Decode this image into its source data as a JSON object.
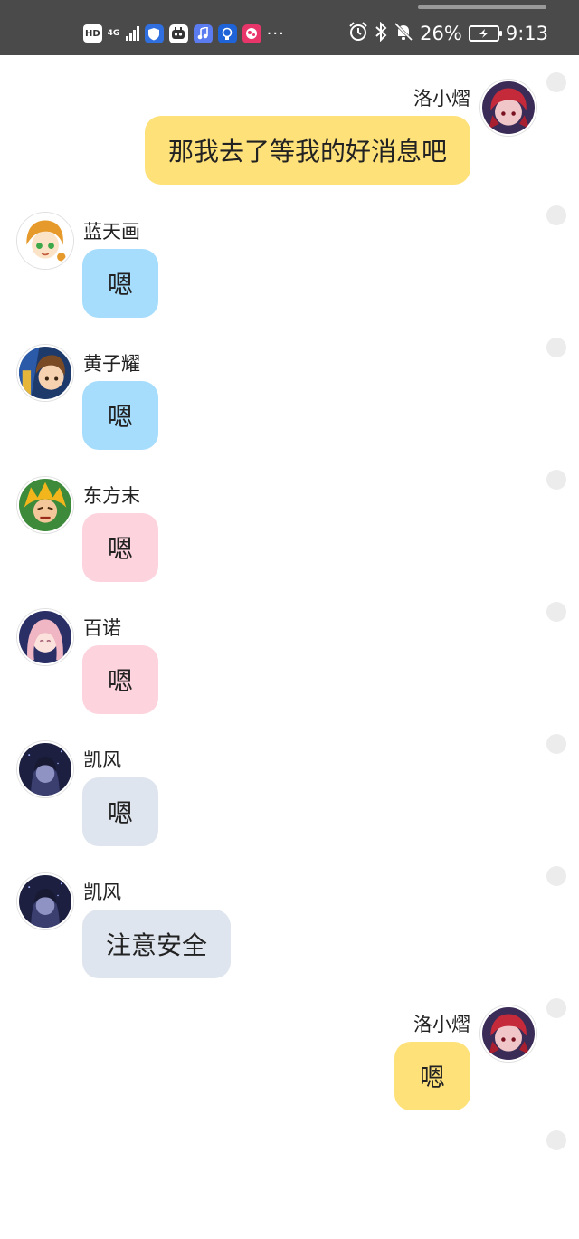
{
  "status_bar": {
    "hd_label": "HD",
    "network_label": "4G",
    "more": "···",
    "battery_percent": "26%",
    "time": "9:13",
    "icons": [
      "hd-icon",
      "signal-4g-icon",
      "shield-app-icon",
      "robot-app-icon",
      "music-app-icon",
      "bulb-app-icon",
      "game-app-icon",
      "alarm-icon",
      "bluetooth-icon",
      "mute-bell-icon",
      "battery-icon"
    ]
  },
  "colors": {
    "status_bar_bg": "#4a4a4a",
    "bubble_self": "#ffe17a",
    "bubble_blue": "#a6dcfc",
    "bubble_pink": "#fdd3de",
    "bubble_gray": "#dfe5ee",
    "dot": "#ececec"
  },
  "messages": [
    {
      "sender": "洛小熠",
      "text": "那我去了等我的好消息吧",
      "side": "right",
      "bubble_color": "#ffe17a",
      "avatar": "red-hair-avatar"
    },
    {
      "sender": "蓝天画",
      "text": "嗯",
      "side": "left",
      "bubble_color": "#a6dcfc",
      "avatar": "green-eyed-girl-avatar"
    },
    {
      "sender": "黄子耀",
      "text": "嗯",
      "side": "left",
      "bubble_color": "#a6dcfc",
      "avatar": "brown-hair-boy-avatar"
    },
    {
      "sender": "东方末",
      "text": "嗯",
      "side": "left",
      "bubble_color": "#fdd3de",
      "avatar": "golden-hair-hero-avatar"
    },
    {
      "sender": "百诺",
      "text": "嗯",
      "side": "left",
      "bubble_color": "#fdd3de",
      "avatar": "pink-hair-girl-avatar"
    },
    {
      "sender": "凯风",
      "text": "嗯",
      "side": "left",
      "bubble_color": "#dfe5ee",
      "avatar": "dark-hooded-avatar"
    },
    {
      "sender": "凯风",
      "text": "注意安全",
      "side": "left",
      "bubble_color": "#dfe5ee",
      "avatar": "dark-hooded-avatar"
    },
    {
      "sender": "洛小熠",
      "text": "嗯",
      "side": "right",
      "bubble_color": "#ffe17a",
      "avatar": "red-hair-avatar"
    }
  ]
}
